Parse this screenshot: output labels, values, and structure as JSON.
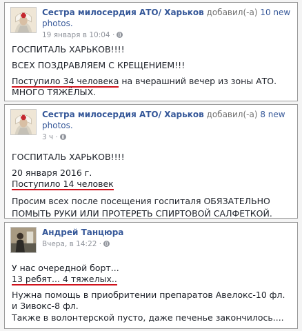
{
  "posts": [
    {
      "author": "Сестра милосердия АТО/ Харьков",
      "action": "добавил(-а)",
      "photos": "10 new photos.",
      "time": "19 января в 10:04 ·",
      "lines": [
        "ГОСПИТАЛЬ ХАРЬКОВ!!!!",
        "ВСЕХ ПОЗДРАВЛЯЕМ С КРЕЩЕНИЕМ!!!",
        "Поступило 34 человека",
        " на вчерашний вечер из зоны АТО.",
        "МНОГО ТЯЖЁЛЫХ."
      ]
    },
    {
      "author": "Сестра милосердия АТО/ Харьков",
      "action": "добавил(-а)",
      "photos": "8 new photos.",
      "time": "3 ч ·",
      "lines": [
        "ГОСПИТАЛЬ ХАРЬКОВ!!!!",
        "20 января 2016 г.",
        "Поступило 14 человек",
        "Просим всех после посещения госпиталя ОБЯЗАТЕЛЬНО ПОМЫТЬ РУКИ ИЛИ ПРОТЕРЕТЬ СПИРТОВОЙ САЛФЕТКОЙ."
      ]
    },
    {
      "author": "Андрей Танцюра",
      "time": "Вчера, в 14:22 ·",
      "lines": [
        "У нас очередной борт...",
        "13 ребят... 4 тяжелых..",
        "Нужна помощь в приобритении препаратов Авелокс-10 фл. и Зивокс-8 фл.",
        "Также в волонтерской пусто, даже печенье закончилось...."
      ]
    }
  ],
  "colors": {
    "author_link": "#365899",
    "meta_text": "#90949c",
    "red_underline": "#d0101a",
    "post_border": "#9a9a9a"
  },
  "icons": {
    "privacy": "globe-icon",
    "avatar_1": "nurse-avatar-icon",
    "avatar_3": "user-avatar-icon"
  }
}
